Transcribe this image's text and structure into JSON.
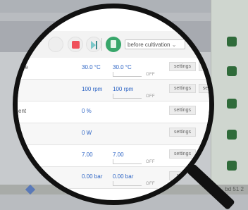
{
  "toolbar": {
    "phase_select_value": "before cultivation"
  },
  "rows": [
    {
      "label": "ture",
      "pv": "30.0 °C",
      "sp": "30.0 °C",
      "off": "OFF",
      "settings": "settings",
      "setpoint": "setpoint"
    },
    {
      "label": "",
      "pv": "100 rpm",
      "sp": "100 rpm",
      "off": "OFF",
      "settings": "settings",
      "setpoint": "setpoint"
    },
    {
      "label": "ent",
      "pv": "0 %",
      "settings": "settings"
    },
    {
      "label": "",
      "pv": "0 W",
      "settings": "settings"
    },
    {
      "label": "",
      "pv": "7.00",
      "sp": "7.00",
      "off": "OFF",
      "settings": "settings",
      "setpoint": "setp"
    },
    {
      "label": "",
      "pv": "0.00 bar",
      "sp": "0.00 bar",
      "off": "OFF",
      "settings": "settin"
    }
  ],
  "status_bar": {
    "text": "bd 51 2"
  },
  "colors": {
    "stop": "#ef4f5a",
    "value_blue": "#2b63c4",
    "accent_green": "#37a66a"
  }
}
